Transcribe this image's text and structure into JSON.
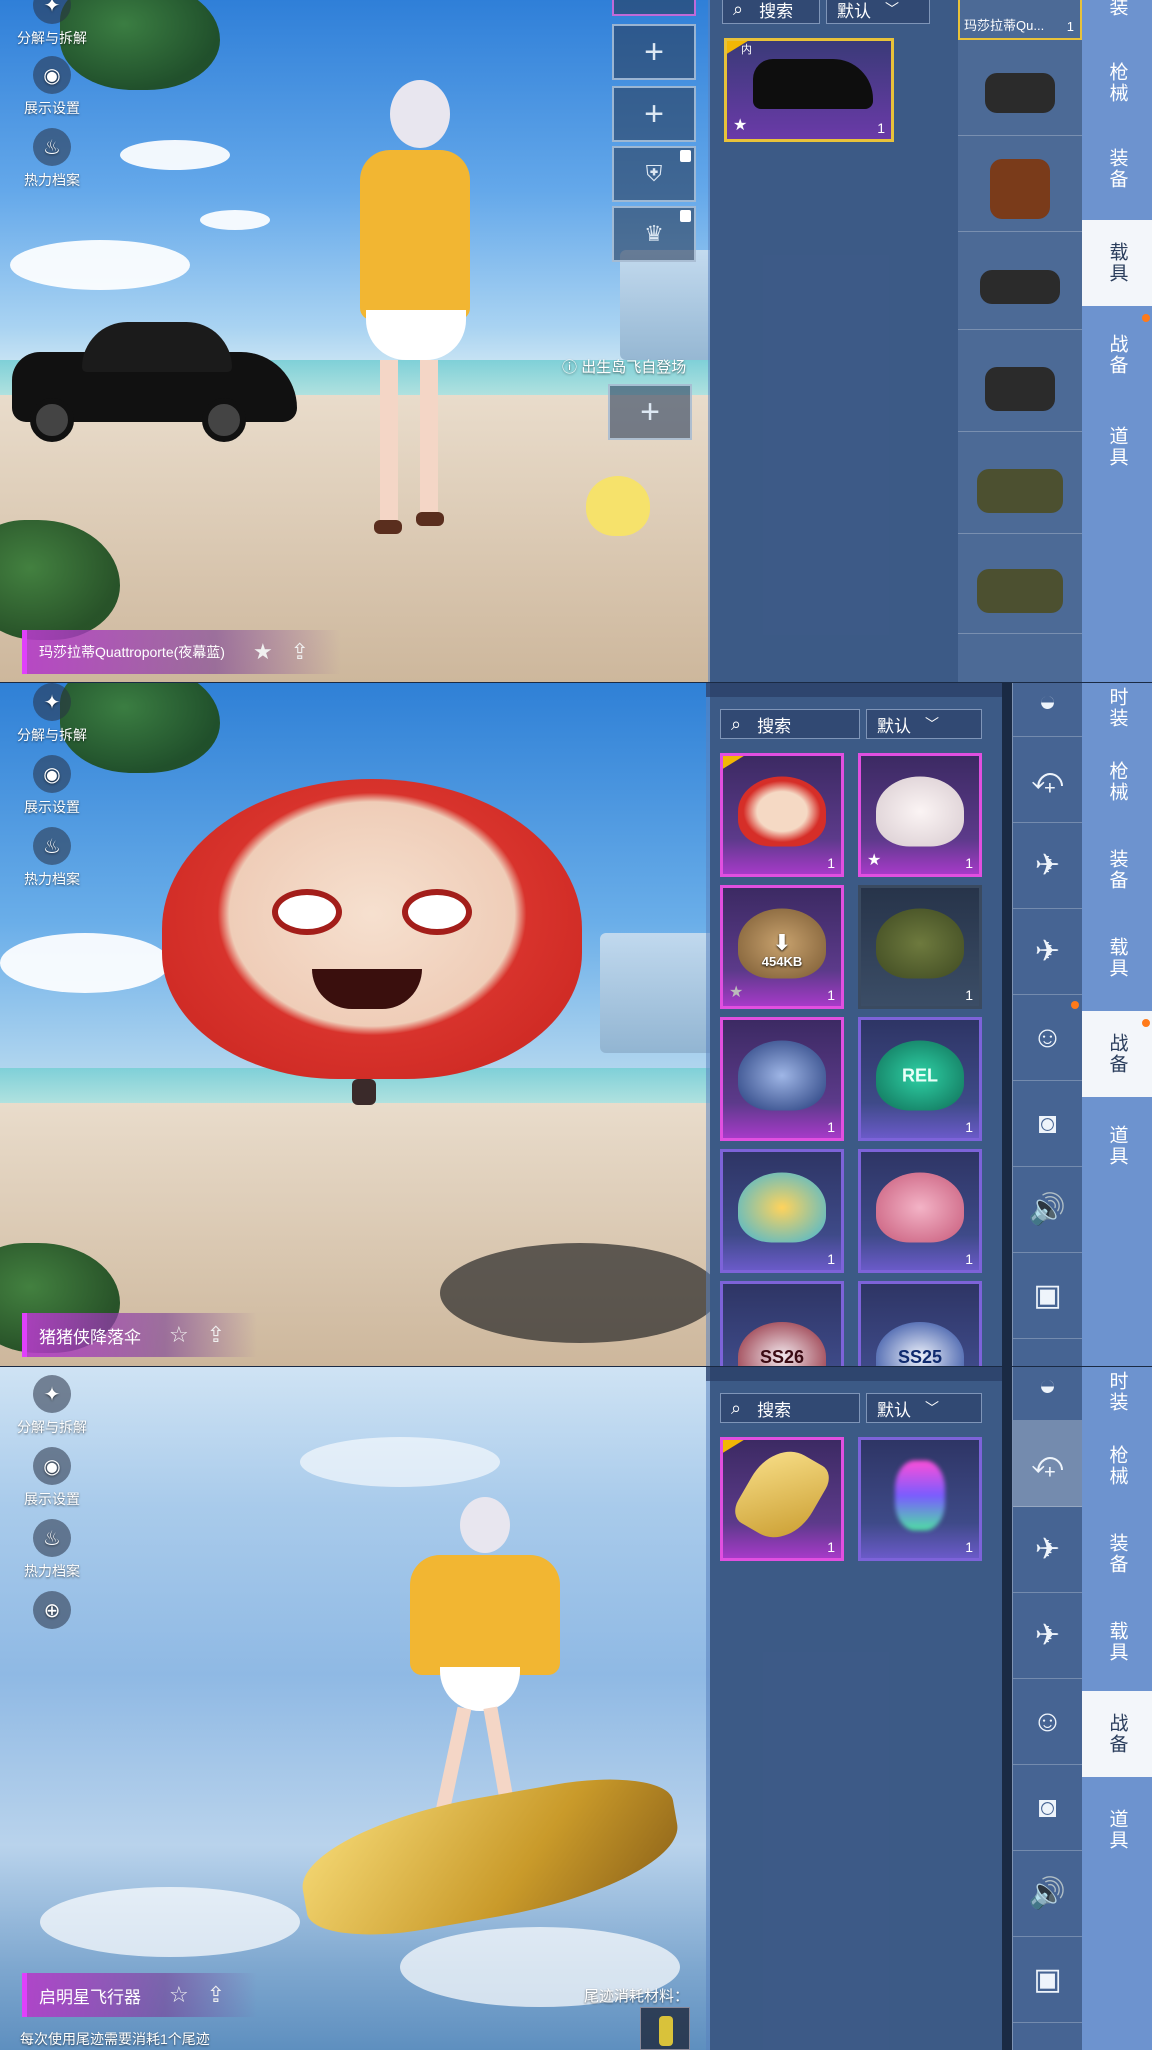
{
  "tools": {
    "disassemble": "分解与拆解",
    "display_settings": "展示设置",
    "heat_archive": "热力档案"
  },
  "panel1": {
    "item_name": "玛莎拉蒂Quattroporte(夜幕蓝)",
    "spawn_hint": "出生岛飞自登场",
    "search": "搜索",
    "sort": "默认",
    "selected_card": {
      "badge": "内",
      "count": "1"
    },
    "vehicle_top_label": "玛莎拉蒂Qu...",
    "vehicle_top_count": "1",
    "categories": [
      "装",
      "枪械",
      "装备",
      "载具",
      "战备",
      "道具"
    ]
  },
  "panel2": {
    "item_name": "猪猪侠降落伞",
    "search": "搜索",
    "sort": "默认",
    "cards": [
      {
        "count": "1"
      },
      {
        "count": "1"
      },
      {
        "count": "1",
        "download": "454KB"
      },
      {
        "count": "1"
      },
      {
        "count": "1"
      },
      {
        "count": "1",
        "text": "REL"
      },
      {
        "count": "1"
      },
      {
        "count": "1"
      },
      {
        "text": "SS26"
      },
      {
        "text": "SS25"
      }
    ],
    "categories": [
      "时装",
      "枪械",
      "装备",
      "载具",
      "战备",
      "道具"
    ]
  },
  "panel3": {
    "item_name": "启明星飞行器",
    "search": "搜索",
    "sort": "默认",
    "cards": [
      {
        "count": "1"
      },
      {
        "count": "1"
      }
    ],
    "trail_material_label": "尾迹消耗材料：",
    "trail_note": "每次使用尾迹需要消耗1个尾迹",
    "categories": [
      "时装",
      "枪械",
      "装备",
      "载具",
      "战备",
      "道具"
    ]
  }
}
